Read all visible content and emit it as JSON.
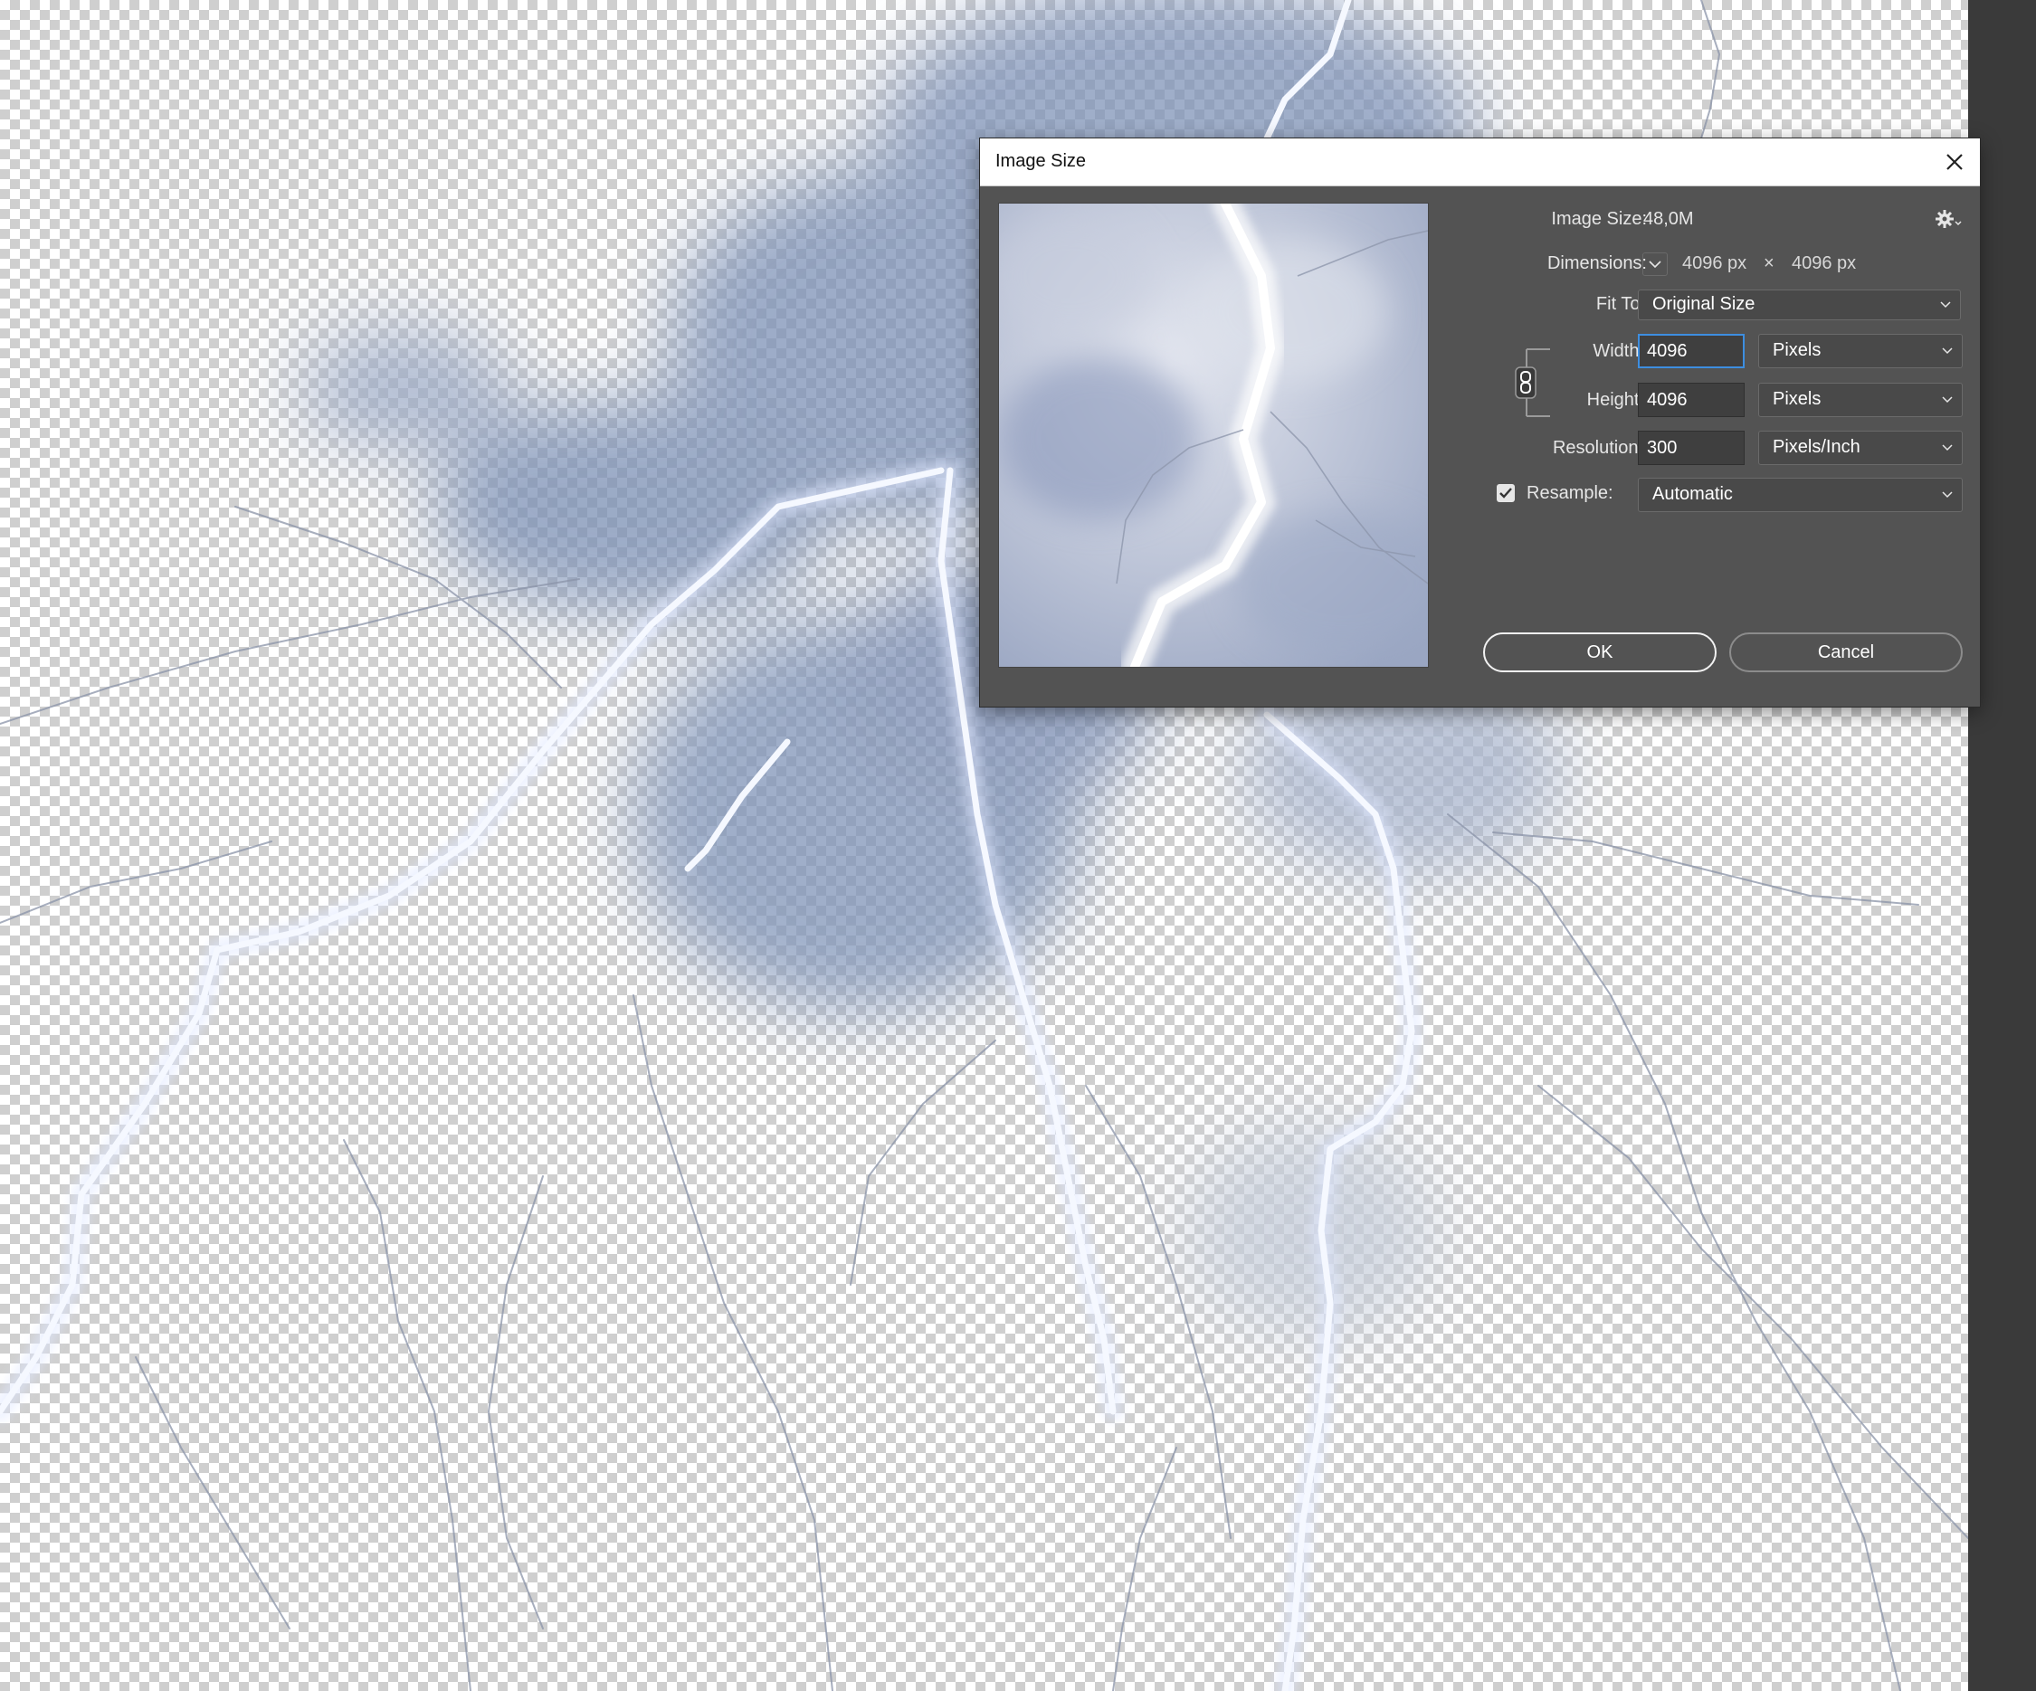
{
  "dialog": {
    "title": "Image Size",
    "image_size_label": "Image Size:",
    "image_size_value": "48,0M",
    "dimensions_label": "Dimensions:",
    "dimensions_width": "4096 px",
    "dimensions_times": "×",
    "dimensions_height": "4096 px",
    "fit_to_label": "Fit To:",
    "fit_to_value": "Original Size",
    "width_label": "Width:",
    "width_value": "4096",
    "width_unit": "Pixels",
    "height_label": "Height:",
    "height_value": "4096",
    "height_unit": "Pixels",
    "resolution_label": "Resolution:",
    "resolution_value": "300",
    "resolution_unit": "Pixels/Inch",
    "resample_label": "Resample:",
    "resample_checked": true,
    "resample_value": "Automatic",
    "ok_label": "OK",
    "cancel_label": "Cancel"
  },
  "colors": {
    "dialog_bg": "#535353",
    "focus_ring": "#3d8ee0",
    "strip": "#3a3a3a"
  },
  "icons": {
    "close": "close-icon",
    "gear": "gear-icon",
    "chain": "chain-link-icon",
    "checkbox": "checkmark-icon",
    "chevron": "chevron-down-icon"
  }
}
